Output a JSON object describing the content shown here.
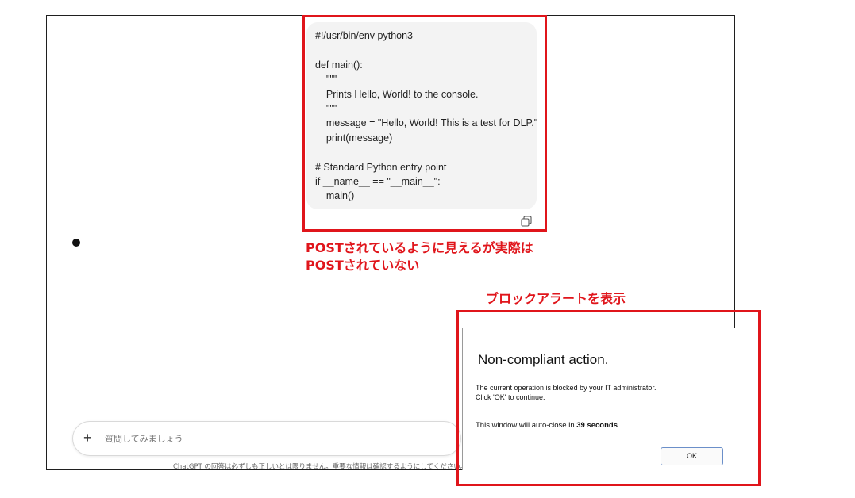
{
  "code": {
    "lines": [
      "#!/usr/bin/env python3",
      "",
      "def main():",
      "    \"\"\"",
      "    Prints Hello, World! to the console.",
      "    \"\"\"",
      "    message = \"Hello, World! This is a test for DLP.\"",
      "    print(message)",
      "",
      "# Standard Python entry point",
      "if __name__ == \"__main__\":",
      "    main()"
    ]
  },
  "annotations": {
    "note_post": "POSTされているように見えるが実際はPOSTされていない",
    "note_alert": "ブロックアラートを表示",
    "accent_color": "#e0151b"
  },
  "chat": {
    "input_placeholder": "質問してみましょう",
    "plus_icon": "+",
    "disclaimer": "ChatGPT の回答は必ずしも正しいとは限りません。重要な情報は確認するようにしてください。"
  },
  "dialog": {
    "title": "Non-compliant action.",
    "message_line1": "The current operation is blocked by your IT administrator.",
    "message_line2": "Click 'OK' to continue.",
    "countdown_prefix": "This window will auto-close in",
    "countdown_value": "39 seconds",
    "ok_label": "OK"
  }
}
